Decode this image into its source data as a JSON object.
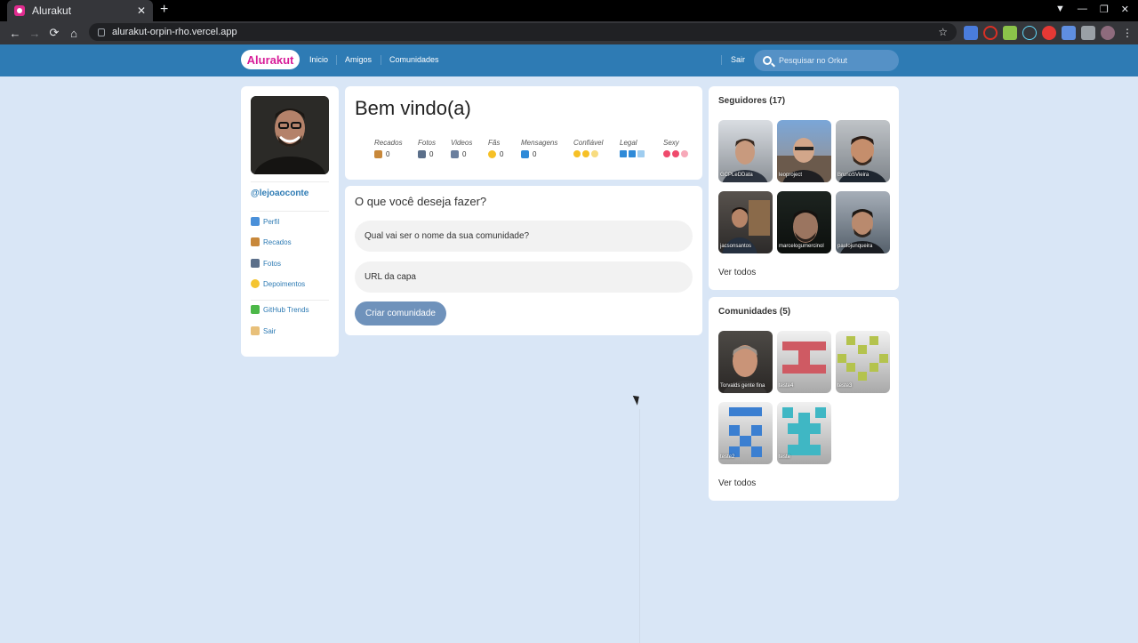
{
  "browser": {
    "tab_title": "Alurakut",
    "tab_close": "✕",
    "new_tab": "+",
    "url": "alurakut-orpin-rho.vercel.app",
    "back": "←",
    "forward": "→",
    "reload": "⟳",
    "home": "⌂",
    "bookmark_star": "☆",
    "minimize": "—",
    "maximize": "❐",
    "close": "✕",
    "profile_menu": "▼"
  },
  "header": {
    "logo": "Alurakut",
    "nav": [
      "Inicio",
      "Amigos",
      "Comunidades"
    ],
    "logout": "Sair",
    "search_placeholder": "Pesquisar no Orkut"
  },
  "sidebar": {
    "username": "@lejoaoconte",
    "items": [
      {
        "label": "Perfil",
        "icon": "user-icon",
        "color": "#4a90d9"
      },
      {
        "label": "Recados",
        "icon": "book-icon",
        "color": "#c8883a"
      },
      {
        "label": "Fotos",
        "icon": "camera-icon",
        "color": "#5b6f8a"
      },
      {
        "label": "Depoimentos",
        "icon": "sun-icon",
        "color": "#f4c430"
      },
      {
        "label": "GitHub Trends",
        "icon": "plus-icon",
        "color": "#4cb848"
      },
      {
        "label": "Sair",
        "icon": "logout-icon",
        "color": "#e8c07a"
      }
    ]
  },
  "welcome": {
    "title": "Bem vindo(a)",
    "stats": [
      {
        "label": "Recados",
        "value": "0",
        "icon": "book-icon"
      },
      {
        "label": "Fotos",
        "value": "0",
        "icon": "camera-icon"
      },
      {
        "label": "Videos",
        "value": "0",
        "icon": "video-icon"
      },
      {
        "label": "Fãs",
        "value": "0",
        "icon": "star-icon"
      },
      {
        "label": "Mensagens",
        "value": "0",
        "icon": "mail-icon"
      }
    ],
    "ratings": [
      {
        "label": "Confiável",
        "icon": "smiley-icon",
        "count": 3
      },
      {
        "label": "Legal",
        "icon": "ice-cube-icon",
        "count": 3
      },
      {
        "label": "Sexy",
        "icon": "heart-icon",
        "count": 3
      }
    ]
  },
  "create": {
    "prompt": "O que você deseja fazer?",
    "name_placeholder": "Qual vai ser o nome da sua comunidade?",
    "cover_placeholder": "URL da capa",
    "button": "Criar comunidade"
  },
  "followers": {
    "title": "Seguidores (17)",
    "items": [
      "GCPLeDData",
      "leoproject",
      "BrunoSVieira",
      "jacsonsantos",
      "marcelogumercinol",
      "paulojunqueira"
    ],
    "see_all": "Ver todos"
  },
  "communities": {
    "title": "Comunidades (5)",
    "items": [
      "Torvalds gente fina",
      "teste4",
      "teste3",
      "teste2",
      "teste"
    ],
    "see_all": "Ver todos"
  },
  "colors": {
    "header": "#2e7bb4",
    "background": "#d9e6f6",
    "logo_text": "#d81d99",
    "link": "#2e7bb4",
    "button": "#6f92bb"
  }
}
